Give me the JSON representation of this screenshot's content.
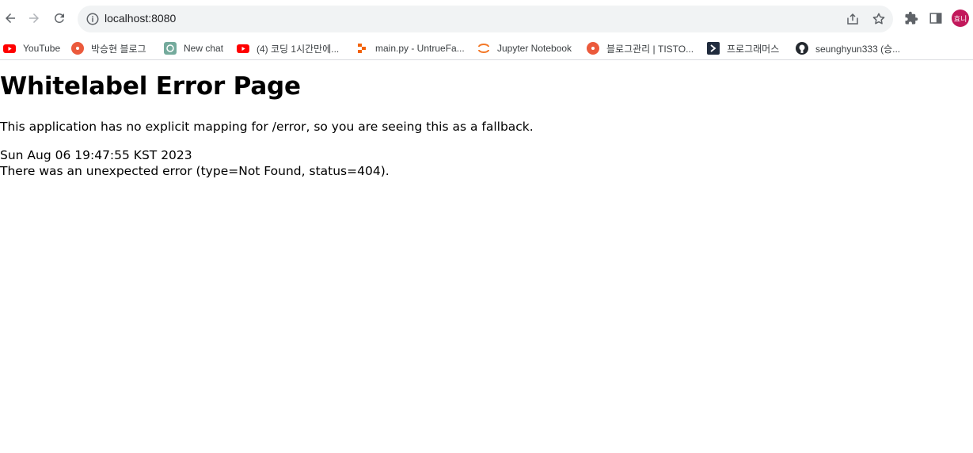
{
  "browser": {
    "url": "localhost:8080",
    "avatar_text": "효니",
    "avatar_color": "#c2185b"
  },
  "bookmarks": [
    {
      "label": "YouTube",
      "icon": "youtube-icon"
    },
    {
      "label": "박승현 블로그",
      "icon": "tistory-icon"
    },
    {
      "label": "New chat",
      "icon": "chatgpt-icon"
    },
    {
      "label": "(4) 코딩 1시간만에...",
      "icon": "youtube-icon"
    },
    {
      "label": "main.py - UntrueFa...",
      "icon": "replit-icon"
    },
    {
      "label": "Jupyter Notebook",
      "icon": "jupyter-icon"
    },
    {
      "label": "블로그관리 | TISTO...",
      "icon": "tistory-icon"
    },
    {
      "label": "프로그래머스",
      "icon": "programmers-icon"
    },
    {
      "label": "seunghyun333 (승...",
      "icon": "github-icon"
    }
  ],
  "page": {
    "title": "Whitelabel Error Page",
    "message": "This application has no explicit mapping for /error, so you are seeing this as a fallback.",
    "timestamp": "Sun Aug 06 19:47:55 KST 2023",
    "error": "There was an unexpected error (type=Not Found, status=404)."
  }
}
